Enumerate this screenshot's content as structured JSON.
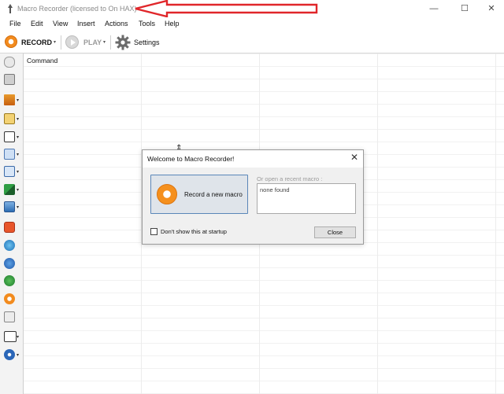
{
  "window": {
    "title": "Macro Recorder (licensed to On HAX)",
    "controls": [
      "—",
      "☐",
      "✕"
    ]
  },
  "menu": [
    "File",
    "Edit",
    "View",
    "Insert",
    "Actions",
    "Tools",
    "Help"
  ],
  "toolbar": {
    "record_label": "RECORD",
    "play_label": "PLAY",
    "settings_label": "Settings"
  },
  "grid": {
    "column_header": "Command"
  },
  "tools": [
    "mouse-icon",
    "keyboard-icon",
    "hourglass-icon",
    "printer-icon",
    "window-icon",
    "files-icon",
    "text-icon",
    "eyedropper-icon",
    "image-icon",
    "power-icon",
    "globe-link-icon",
    "info-icon",
    "globe-icon",
    "play-orange-icon",
    "clipboard-icon",
    "if-icon",
    "loop-icon"
  ],
  "dialog": {
    "title": "Welcome to Macro Recorder!",
    "record_button": "Record a new macro",
    "recent_label": "Or open a recent macro :",
    "recent_items": [
      "none found"
    ],
    "dont_show_label": "Don't show this at startup",
    "dont_show_checked": false,
    "close_label": "Close"
  },
  "colors": {
    "record_orange": "#f28b1e",
    "annotation_arrow": "#e0262a",
    "dialog_button_border": "#5a86b8"
  }
}
